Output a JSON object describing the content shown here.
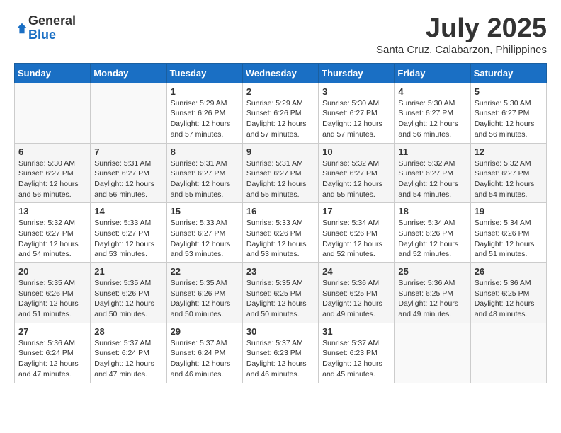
{
  "logo": {
    "general": "General",
    "blue": "Blue"
  },
  "title": "July 2025",
  "subtitle": "Santa Cruz, Calabarzon, Philippines",
  "days_header": [
    "Sunday",
    "Monday",
    "Tuesday",
    "Wednesday",
    "Thursday",
    "Friday",
    "Saturday"
  ],
  "weeks": [
    [
      {
        "num": "",
        "info": ""
      },
      {
        "num": "",
        "info": ""
      },
      {
        "num": "1",
        "info": "Sunrise: 5:29 AM\nSunset: 6:26 PM\nDaylight: 12 hours and 57 minutes."
      },
      {
        "num": "2",
        "info": "Sunrise: 5:29 AM\nSunset: 6:26 PM\nDaylight: 12 hours and 57 minutes."
      },
      {
        "num": "3",
        "info": "Sunrise: 5:30 AM\nSunset: 6:27 PM\nDaylight: 12 hours and 57 minutes."
      },
      {
        "num": "4",
        "info": "Sunrise: 5:30 AM\nSunset: 6:27 PM\nDaylight: 12 hours and 56 minutes."
      },
      {
        "num": "5",
        "info": "Sunrise: 5:30 AM\nSunset: 6:27 PM\nDaylight: 12 hours and 56 minutes."
      }
    ],
    [
      {
        "num": "6",
        "info": "Sunrise: 5:30 AM\nSunset: 6:27 PM\nDaylight: 12 hours and 56 minutes."
      },
      {
        "num": "7",
        "info": "Sunrise: 5:31 AM\nSunset: 6:27 PM\nDaylight: 12 hours and 56 minutes."
      },
      {
        "num": "8",
        "info": "Sunrise: 5:31 AM\nSunset: 6:27 PM\nDaylight: 12 hours and 55 minutes."
      },
      {
        "num": "9",
        "info": "Sunrise: 5:31 AM\nSunset: 6:27 PM\nDaylight: 12 hours and 55 minutes."
      },
      {
        "num": "10",
        "info": "Sunrise: 5:32 AM\nSunset: 6:27 PM\nDaylight: 12 hours and 55 minutes."
      },
      {
        "num": "11",
        "info": "Sunrise: 5:32 AM\nSunset: 6:27 PM\nDaylight: 12 hours and 54 minutes."
      },
      {
        "num": "12",
        "info": "Sunrise: 5:32 AM\nSunset: 6:27 PM\nDaylight: 12 hours and 54 minutes."
      }
    ],
    [
      {
        "num": "13",
        "info": "Sunrise: 5:32 AM\nSunset: 6:27 PM\nDaylight: 12 hours and 54 minutes."
      },
      {
        "num": "14",
        "info": "Sunrise: 5:33 AM\nSunset: 6:27 PM\nDaylight: 12 hours and 53 minutes."
      },
      {
        "num": "15",
        "info": "Sunrise: 5:33 AM\nSunset: 6:27 PM\nDaylight: 12 hours and 53 minutes."
      },
      {
        "num": "16",
        "info": "Sunrise: 5:33 AM\nSunset: 6:26 PM\nDaylight: 12 hours and 53 minutes."
      },
      {
        "num": "17",
        "info": "Sunrise: 5:34 AM\nSunset: 6:26 PM\nDaylight: 12 hours and 52 minutes."
      },
      {
        "num": "18",
        "info": "Sunrise: 5:34 AM\nSunset: 6:26 PM\nDaylight: 12 hours and 52 minutes."
      },
      {
        "num": "19",
        "info": "Sunrise: 5:34 AM\nSunset: 6:26 PM\nDaylight: 12 hours and 51 minutes."
      }
    ],
    [
      {
        "num": "20",
        "info": "Sunrise: 5:35 AM\nSunset: 6:26 PM\nDaylight: 12 hours and 51 minutes."
      },
      {
        "num": "21",
        "info": "Sunrise: 5:35 AM\nSunset: 6:26 PM\nDaylight: 12 hours and 50 minutes."
      },
      {
        "num": "22",
        "info": "Sunrise: 5:35 AM\nSunset: 6:26 PM\nDaylight: 12 hours and 50 minutes."
      },
      {
        "num": "23",
        "info": "Sunrise: 5:35 AM\nSunset: 6:25 PM\nDaylight: 12 hours and 50 minutes."
      },
      {
        "num": "24",
        "info": "Sunrise: 5:36 AM\nSunset: 6:25 PM\nDaylight: 12 hours and 49 minutes."
      },
      {
        "num": "25",
        "info": "Sunrise: 5:36 AM\nSunset: 6:25 PM\nDaylight: 12 hours and 49 minutes."
      },
      {
        "num": "26",
        "info": "Sunrise: 5:36 AM\nSunset: 6:25 PM\nDaylight: 12 hours and 48 minutes."
      }
    ],
    [
      {
        "num": "27",
        "info": "Sunrise: 5:36 AM\nSunset: 6:24 PM\nDaylight: 12 hours and 47 minutes."
      },
      {
        "num": "28",
        "info": "Sunrise: 5:37 AM\nSunset: 6:24 PM\nDaylight: 12 hours and 47 minutes."
      },
      {
        "num": "29",
        "info": "Sunrise: 5:37 AM\nSunset: 6:24 PM\nDaylight: 12 hours and 46 minutes."
      },
      {
        "num": "30",
        "info": "Sunrise: 5:37 AM\nSunset: 6:23 PM\nDaylight: 12 hours and 46 minutes."
      },
      {
        "num": "31",
        "info": "Sunrise: 5:37 AM\nSunset: 6:23 PM\nDaylight: 12 hours and 45 minutes."
      },
      {
        "num": "",
        "info": ""
      },
      {
        "num": "",
        "info": ""
      }
    ]
  ]
}
